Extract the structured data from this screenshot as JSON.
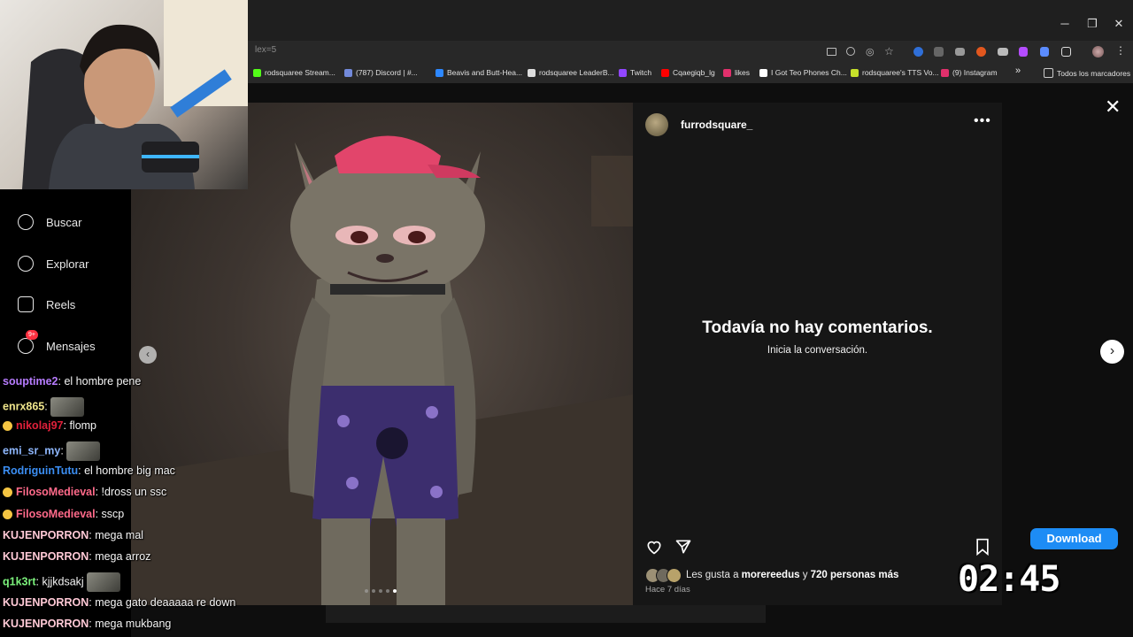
{
  "window": {
    "controls": [
      "─",
      "❐",
      "✕"
    ]
  },
  "browser": {
    "url_fragment": "lex=5",
    "bookmarks": [
      {
        "label": "rodsquaree Stream...",
        "color": "#53fc18"
      },
      {
        "label": "(787) Discord | #...",
        "color": "#7289da"
      },
      {
        "label": "Beavis and Butt-Hea...",
        "color": "#2d88ff"
      },
      {
        "label": "rodsquaree LeaderB...",
        "color": "#dddddd"
      },
      {
        "label": "Twitch",
        "color": "#9146ff"
      },
      {
        "label": "Cqaegiqb_lg",
        "color": "#ff0000"
      },
      {
        "label": "likes",
        "color": "#e1306c"
      },
      {
        "label": "I Got Teo Phones Ch...",
        "color": "#ffffff"
      },
      {
        "label": "rodsquaree's TTS Vo...",
        "color": "#c6e02a"
      },
      {
        "label": "(9) Instagram",
        "color": "#e1306c"
      }
    ],
    "bookmarks_overflow": "»",
    "all_bookmarks_label": "Todos los marcadores"
  },
  "sidebar": {
    "items": [
      {
        "label": "Buscar",
        "icon": "search-icon"
      },
      {
        "label": "Explorar",
        "icon": "compass-icon"
      },
      {
        "label": "Reels",
        "icon": "reels-icon"
      },
      {
        "label": "Mensajes",
        "icon": "messenger-icon",
        "badge": "9+"
      }
    ]
  },
  "post": {
    "username": "furrodsquare_",
    "more_label": "•••",
    "no_comments_title": "Todavía no hay comentarios.",
    "no_comments_sub": "Inicia la conversación.",
    "likes_prefix": "Les gusta a ",
    "likes_user": "morereedus",
    "likes_mid": " y ",
    "likes_count": "720 personas más",
    "timestamp": "Hace 7 días",
    "carousel_active_index": 4,
    "carousel_total": 5
  },
  "controls": {
    "close": "✕",
    "next": "›",
    "prev": "‹",
    "download_label": "Download"
  },
  "timer": "02:45",
  "chat": [
    {
      "user": "souptime2",
      "color": "#b77cff",
      "text": ": el hombre pene",
      "badge": false,
      "emote": false
    },
    {
      "user": "enrx865",
      "color": "#f0e68c",
      "text": ":",
      "badge": false,
      "emote": true
    },
    {
      "user": "nikolaj97",
      "color": "#e0203a",
      "text": ": flomp",
      "badge": true,
      "emote": false
    },
    {
      "user": "emi_sr_my",
      "color": "#8fb8ff",
      "text": ":",
      "badge": false,
      "emote": true
    },
    {
      "user": "RodriguinTutu",
      "color": "#3b8ef3",
      "text": ": el hombre big mac",
      "badge": false,
      "emote": false
    },
    {
      "user": "FilosoMedieval",
      "color": "#ff6a8a",
      "text": ": !dross un ssc",
      "badge": true,
      "emote": false
    },
    {
      "user": "FilosoMedieval",
      "color": "#ff6a8a",
      "text": ": sscp",
      "badge": true,
      "emote": false
    },
    {
      "user": "KUJENPORRON",
      "color": "#ffc9d6",
      "text": ": mega mal",
      "badge": false,
      "emote": false
    },
    {
      "user": "KUJENPORRON",
      "color": "#ffc9d6",
      "text": ": mega arroz",
      "badge": false,
      "emote": false
    },
    {
      "user": "q1k3rt",
      "color": "#7cf27c",
      "text": ": kjjkdsakj",
      "badge": false,
      "emote": true
    },
    {
      "user": "KUJENPORRON",
      "color": "#ffc9d6",
      "text": ": mega gato deaaaaa re down",
      "badge": false,
      "emote": false
    },
    {
      "user": "KUJENPORRON",
      "color": "#ffc9d6",
      "text": ": mega mukbang",
      "badge": false,
      "emote": false
    }
  ]
}
